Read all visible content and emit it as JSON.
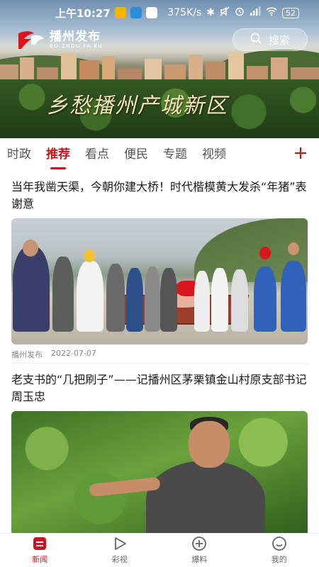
{
  "status_bar": {
    "time": "上午10:27",
    "network_speed": "375K/s",
    "battery": "52",
    "app_dot_colors": [
      "#f5b400",
      "#2a8bd8",
      "#ffffff"
    ]
  },
  "header": {
    "logo_cn": "播州发布",
    "logo_en": "BO ZHOU FA BU",
    "search_label": "搜索",
    "banner_slogan": "乡愁播州产城新区"
  },
  "tabs": [
    {
      "label": "时政",
      "active": false
    },
    {
      "label": "推荐",
      "active": true
    },
    {
      "label": "看点",
      "active": false
    },
    {
      "label": "便民",
      "active": false
    },
    {
      "label": "专题",
      "active": false
    },
    {
      "label": "视频",
      "active": false
    }
  ],
  "articles": [
    {
      "title": "当年我凿天渠，今朝你建大桥！时代楷模黄大发杀“年猪”表谢意",
      "source": "播州发布",
      "date": "2022-07-07"
    },
    {
      "title": "老支书的“几把刷子”——记播州区茅栗镇金山村原支部书记周玉忠"
    }
  ],
  "bottom_nav": [
    {
      "label": "新闻",
      "icon": "news-icon",
      "active": true
    },
    {
      "label": "彩视",
      "icon": "play-icon",
      "active": false
    },
    {
      "label": "爆料",
      "icon": "plus-circle-icon",
      "active": false
    },
    {
      "label": "我的",
      "icon": "smile-icon",
      "active": false
    }
  ],
  "colors": {
    "accent": "#c8161e",
    "text": "#1a1a1a",
    "muted": "#888888"
  }
}
